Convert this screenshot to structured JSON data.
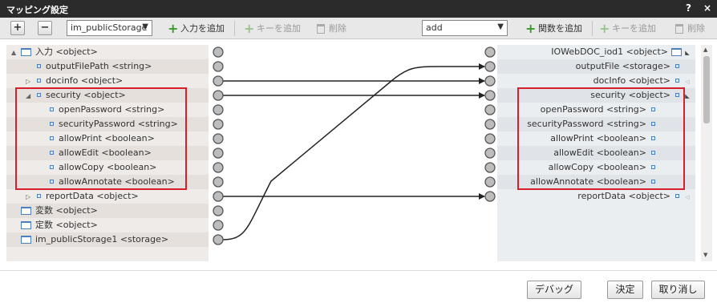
{
  "window": {
    "title": "マッピング設定",
    "help_label": "?",
    "close_label": "×"
  },
  "toolbar": {
    "expand_label": "+",
    "collapse_label": "−",
    "source_select": "im_publicStorage",
    "add_input_label": "入力を追加",
    "add_key_left_label": "キーを追加",
    "delete_left_label": "削除",
    "function_select": "add",
    "add_function_label": "関数を追加",
    "add_key_right_label": "キーを追加",
    "delete_right_label": "削除"
  },
  "left_tree": [
    {
      "label": "入力 <object>",
      "icon": "object-icon",
      "toggle": "▲"
    },
    {
      "label": "outputFilePath <string>",
      "icon": "field-icon",
      "toggle": ""
    },
    {
      "label": "docinfo <object>",
      "icon": "field-icon",
      "toggle": "▷"
    },
    {
      "label": "security <object>",
      "icon": "field-icon",
      "toggle": "◢"
    },
    {
      "label": "openPassword <string>",
      "icon": "field-icon",
      "toggle": ""
    },
    {
      "label": "securityPassword <string>",
      "icon": "field-icon",
      "toggle": ""
    },
    {
      "label": "allowPrint <boolean>",
      "icon": "field-icon",
      "toggle": ""
    },
    {
      "label": "allowEdit <boolean>",
      "icon": "field-icon",
      "toggle": ""
    },
    {
      "label": "allowCopy <boolean>",
      "icon": "field-icon",
      "toggle": ""
    },
    {
      "label": "allowAnnotate <boolean>",
      "icon": "field-icon",
      "toggle": ""
    },
    {
      "label": "reportData <object>",
      "icon": "field-icon",
      "toggle": "▷"
    },
    {
      "label": "変数 <object>",
      "icon": "object-icon",
      "toggle": ""
    },
    {
      "label": "定数 <object>",
      "icon": "object-icon",
      "toggle": ""
    },
    {
      "label": "im_publicStorage1 <storage>",
      "icon": "object-icon",
      "toggle": ""
    }
  ],
  "right_tree": [
    {
      "label": "IOWebDOC_iod1 <object>",
      "icon": "object-icon",
      "marker": "◣"
    },
    {
      "label": "outputFile <storage>",
      "icon": "field-icon",
      "marker": ""
    },
    {
      "label": "docInfo <object>",
      "icon": "field-icon",
      "marker": "◁"
    },
    {
      "label": "security <object>",
      "icon": "field-icon",
      "marker": "◣"
    },
    {
      "label": "openPassword <string>",
      "icon": "field-icon",
      "marker": ""
    },
    {
      "label": "securityPassword <string>",
      "icon": "field-icon",
      "marker": ""
    },
    {
      "label": "allowPrint <boolean>",
      "icon": "field-icon",
      "marker": ""
    },
    {
      "label": "allowEdit <boolean>",
      "icon": "field-icon",
      "marker": ""
    },
    {
      "label": "allowCopy <boolean>",
      "icon": "field-icon",
      "marker": ""
    },
    {
      "label": "allowAnnotate <boolean>",
      "icon": "field-icon",
      "marker": ""
    },
    {
      "label": "reportData <object>",
      "icon": "field-icon",
      "marker": "◁"
    }
  ],
  "connections": [
    {
      "from": "im_publicStorage1 <storage>",
      "to": "outputFile <storage>"
    },
    {
      "from": "docinfo <object>",
      "to": "docInfo <object>"
    },
    {
      "from": "security <object>",
      "to": "security <object>"
    },
    {
      "from": "reportData <object>",
      "to": "reportData <object>"
    }
  ],
  "colors": {
    "highlight": "#d61f2a",
    "title_bar": "#2b2b2b",
    "add_icon": "#3a9a2a",
    "field_icon": "#4a7fc0"
  },
  "footer": {
    "debug_label": "デバッグ",
    "ok_label": "決定",
    "cancel_label": "取り消し"
  }
}
